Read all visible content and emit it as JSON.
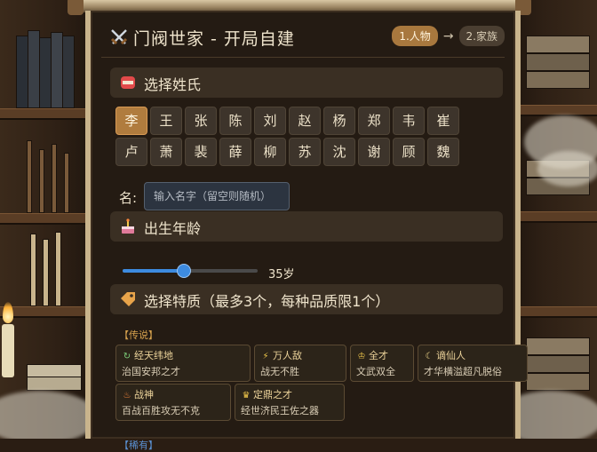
{
  "header": {
    "title": "门阀世家 - 开局自建",
    "step1": "1.人物",
    "step_arrow": "→",
    "step2": "2.家族"
  },
  "sections": {
    "surname": "选择姓氏",
    "age": "出生年龄",
    "traits": "选择特质（最多3个，每种品质限1个）"
  },
  "surnames": [
    [
      "李",
      "王",
      "张",
      "陈",
      "刘",
      "赵",
      "杨",
      "郑",
      "韦",
      "崔"
    ],
    [
      "卢",
      "萧",
      "裴",
      "薛",
      "柳",
      "苏",
      "沈",
      "谢",
      "顾",
      "魏"
    ]
  ],
  "selected_surname": "李",
  "name": {
    "label": "名:",
    "placeholder": "输入名字（留空则随机）",
    "value": ""
  },
  "age": {
    "value": 35,
    "min": 15,
    "max": 60,
    "display": "35岁"
  },
  "trait_tiers": [
    {
      "label": "【传说】",
      "traits": [
        {
          "icon": "recycle-icon",
          "glyph": "↻",
          "color": "#7ed07a",
          "name": "经天纬地",
          "desc": "治国安邦之才"
        },
        {
          "icon": "lightning-icon",
          "glyph": "⚡",
          "color": "#f2c94c",
          "name": "万人敌",
          "desc": "战无不胜"
        },
        {
          "icon": "crown-icon",
          "glyph": "♔",
          "color": "#f2c94c",
          "name": "全才",
          "desc": "文武双全"
        },
        {
          "icon": "moon-icon",
          "glyph": "☾",
          "color": "#f2d98a",
          "name": "谪仙人",
          "desc": "才华横溢超凡脱俗"
        },
        {
          "icon": "fire-icon",
          "glyph": "♨",
          "color": "#ff8a3d",
          "name": "战神",
          "desc": "百战百胜攻无不克"
        },
        {
          "icon": "trophy-icon",
          "glyph": "♛",
          "color": "#f2c94c",
          "name": "定鼎之才",
          "desc": "经世济民王佐之器"
        }
      ]
    }
  ],
  "next_tier_partial": "【稀有】"
}
